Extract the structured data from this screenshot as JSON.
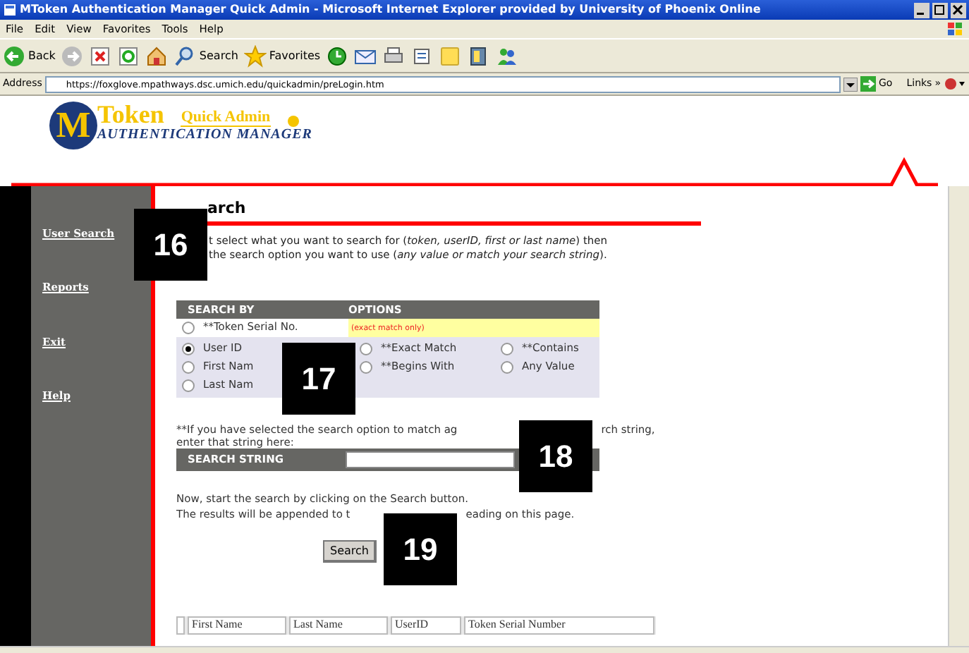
{
  "window": {
    "title": "MToken Authentication Manager Quick Admin - Microsoft Internet Explorer provided by University of Phoenix Online"
  },
  "menu": [
    "File",
    "Edit",
    "View",
    "Favorites",
    "Tools",
    "Help"
  ],
  "toolbar": [
    {
      "kind": "back",
      "label": "Back"
    },
    {
      "kind": "forward"
    },
    {
      "kind": "stop"
    },
    {
      "kind": "refresh"
    },
    {
      "kind": "home"
    },
    {
      "kind": "search",
      "label": "Search"
    },
    {
      "kind": "favorites",
      "label": "Favorites"
    },
    {
      "kind": "history"
    },
    {
      "kind": "mail"
    },
    {
      "kind": "print"
    },
    {
      "kind": "edit"
    },
    {
      "kind": "note"
    },
    {
      "kind": "research"
    },
    {
      "kind": "messenger"
    }
  ],
  "address": {
    "label": "Address",
    "url": "https://foxglove.mpathways.dsc.umich.edu/quickadmin/preLogin.htm",
    "go": "Go",
    "links": "Links",
    "links_chevron": "»"
  },
  "header": {
    "logo_letter": "M",
    "logo_title": "Token",
    "subtitle": "Quick Admin",
    "tagline": "AUTHENTICATION MANAGER"
  },
  "sidebar": {
    "items": [
      "User Search",
      "Reports",
      "Exit",
      "Help"
    ]
  },
  "heading": "arch",
  "intro": [
    "t select what you want to search for (*token, userID, first or last name*) then",
    "the search option you want to use (*any value or match your search string*)."
  ],
  "search_table": {
    "columns": [
      "SEARCH BY",
      "OPTIONS"
    ],
    "note": "(exact match only)",
    "search_by": [
      {
        "label": "**Token Serial No.",
        "selected": false
      },
      {
        "label": "User ID",
        "selected": true
      },
      {
        "label": "First Nam",
        "selected": false
      },
      {
        "label": "Last Nam",
        "selected": false
      }
    ],
    "options": [
      {
        "label": "**Exact Match",
        "selected": false
      },
      {
        "label": "**Contains",
        "selected": false
      },
      {
        "label": "**Begins With",
        "selected": false
      },
      {
        "label": "Any Value",
        "selected": false
      }
    ]
  },
  "match_note": {
    "line_1": [
      "**If you have selected the search option to match ag",
      "rch string,"
    ],
    "line_2": "enter that string here:"
  },
  "search_string": {
    "label": "SEARCH STRING"
  },
  "instructions": {
    "line_1": "Now, start the search by clicking on the Search button.",
    "line_2": [
      "The results will be appended to t",
      "eading on this page."
    ]
  },
  "search_button": "Search",
  "results": {
    "columns": [
      "First Name",
      "Last Name",
      "UserID",
      "Token Serial Number"
    ]
  },
  "callouts": [
    "16",
    "17",
    "18",
    "19"
  ]
}
